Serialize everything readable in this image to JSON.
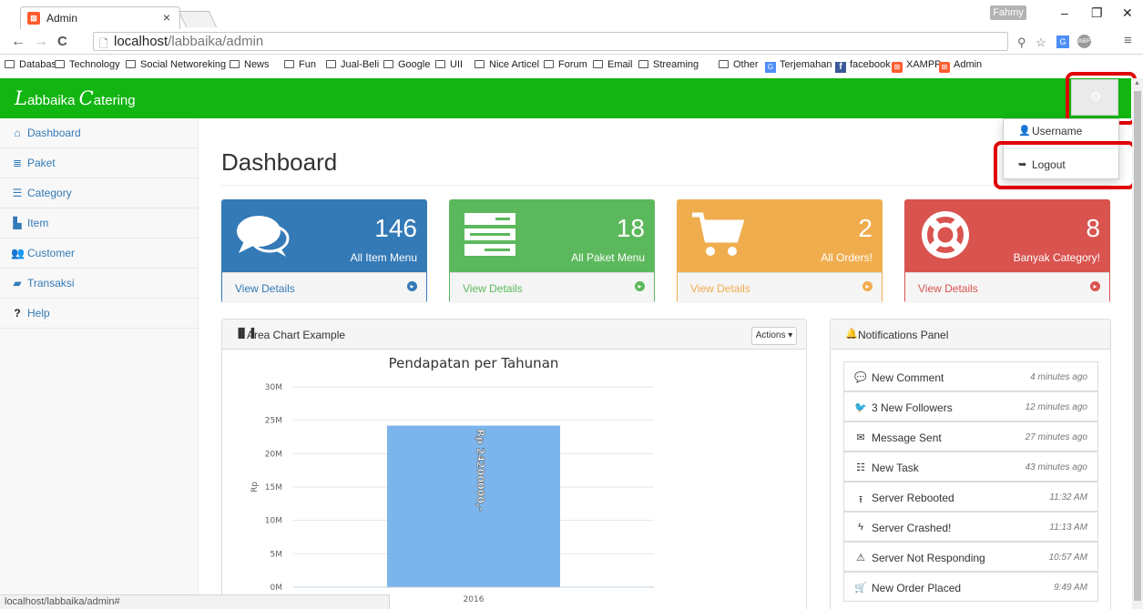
{
  "browser": {
    "tab_title": "Admin",
    "tab_close": "×",
    "user_badge": "Fahmy",
    "window_minimize": "–",
    "window_restore": "❐",
    "window_close": "✕",
    "url_host": "localhost",
    "url_path": "/labbaika/admin",
    "status_text": "localhost/labbaika/admin#",
    "bookmarks": [
      {
        "label": "Database",
        "type": "folder"
      },
      {
        "label": "Technology",
        "type": "folder"
      },
      {
        "label": "Social Networeking",
        "type": "folder"
      },
      {
        "label": "News",
        "type": "folder"
      },
      {
        "label": "Fun",
        "type": "folder"
      },
      {
        "label": "Jual-Beli",
        "type": "folder"
      },
      {
        "label": "Google",
        "type": "folder"
      },
      {
        "label": "UII",
        "type": "folder"
      },
      {
        "label": "Nice Articel",
        "type": "folder"
      },
      {
        "label": "Forum",
        "type": "folder"
      },
      {
        "label": "Email",
        "type": "folder"
      },
      {
        "label": "Streaming",
        "type": "folder"
      },
      {
        "label": "Other",
        "type": "folder"
      },
      {
        "label": "Terjemahan",
        "type": "translate"
      },
      {
        "label": "facebook",
        "type": "facebook"
      },
      {
        "label": "XAMPP",
        "type": "xampp"
      },
      {
        "label": "Admin",
        "type": "xampp"
      }
    ]
  },
  "app": {
    "brand_cap1": "L",
    "brand_rest1": "abbaika ",
    "brand_cap2": "C",
    "brand_rest2": "atering",
    "navbar_color": "#12b512"
  },
  "dropdown": {
    "username": "Username",
    "logout": "Logout"
  },
  "sidebar": {
    "items": [
      {
        "label": "Dashboard",
        "icon": "home-icon"
      },
      {
        "label": "Paket",
        "icon": "database-icon"
      },
      {
        "label": "Category",
        "icon": "list-icon"
      },
      {
        "label": "Item",
        "icon": "file-icon"
      },
      {
        "label": "Customer",
        "icon": "users-icon"
      },
      {
        "label": "Transaksi",
        "icon": "sticky-note-icon"
      },
      {
        "label": "Help",
        "icon": "question-icon"
      }
    ]
  },
  "page": {
    "title": "Dashboard"
  },
  "stats": [
    {
      "value": "146",
      "label": "All Item Menu",
      "link": "View Details",
      "color": "#337ab7",
      "icon": "comments-icon"
    },
    {
      "value": "18",
      "label": "All Paket Menu",
      "link": "View Details",
      "color": "#5cb85c",
      "icon": "server-icon"
    },
    {
      "value": "2",
      "label": "All Orders!",
      "link": "View Details",
      "color": "#f0ad4e",
      "icon": "shopping-cart-icon"
    },
    {
      "value": "8",
      "label": "Banyak Category!",
      "link": "View Details",
      "color": "#d9534f",
      "icon": "life-ring-icon"
    }
  ],
  "chart_panel": {
    "heading": "Area Chart Example",
    "actions_label": "Actions ▾"
  },
  "chart_data": {
    "type": "bar",
    "title": "Pendapatan per Tahunan",
    "xlabel": "",
    "ylabel": "Rp",
    "categories": [
      "2016"
    ],
    "values": [
      24200000
    ],
    "data_labels": [
      "Rp 24200000,-"
    ],
    "ylim": [
      0,
      30000000
    ],
    "yticks": [
      {
        "value": 0,
        "label": "0M"
      },
      {
        "value": 5000000,
        "label": "5M"
      },
      {
        "value": 10000000,
        "label": "10M"
      },
      {
        "value": 15000000,
        "label": "15M"
      },
      {
        "value": 20000000,
        "label": "20M"
      },
      {
        "value": 25000000,
        "label": "25M"
      },
      {
        "value": 30000000,
        "label": "30M"
      }
    ],
    "bar_color": "#7cb5ec",
    "grid": true
  },
  "notifications": {
    "heading": "Notifications Panel",
    "items": [
      {
        "label": "New Comment",
        "time": "4 minutes ago",
        "icon": "comment-icon"
      },
      {
        "label": "3 New Followers",
        "time": "12 minutes ago",
        "icon": "twitter-icon"
      },
      {
        "label": "Message Sent",
        "time": "27 minutes ago",
        "icon": "envelope-icon"
      },
      {
        "label": "New Task",
        "time": "43 minutes ago",
        "icon": "tasks-icon"
      },
      {
        "label": "Server Rebooted",
        "time": "11:32 AM",
        "icon": "upload-icon"
      },
      {
        "label": "Server Crashed!",
        "time": "11:13 AM",
        "icon": "bolt-icon"
      },
      {
        "label": "Server Not Responding",
        "time": "10:57 AM",
        "icon": "warning-icon"
      },
      {
        "label": "New Order Placed",
        "time": "9:49 AM",
        "icon": "cart-icon"
      }
    ]
  }
}
